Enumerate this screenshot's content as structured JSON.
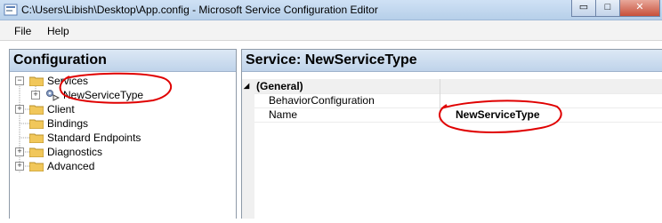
{
  "window": {
    "title": "C:\\Users\\Libish\\Desktop\\App.config - Microsoft Service Configuration Editor",
    "buttons": {
      "minimize": "▭",
      "maximize": "□",
      "close": "✕"
    }
  },
  "menu": {
    "file": "File",
    "help": "Help"
  },
  "left_pane": {
    "header": "Configuration",
    "tree": {
      "services": "Services",
      "service_child": "NewServiceType",
      "client": "Client",
      "bindings": "Bindings",
      "standard_endpoints": "Standard Endpoints",
      "diagnostics": "Diagnostics",
      "advanced": "Advanced"
    },
    "expander_collapsed": "+",
    "expander_expanded": "−"
  },
  "right_pane": {
    "header": "Service: NewServiceType",
    "category": {
      "toggle": "◢",
      "label": "(General)"
    },
    "properties": [
      {
        "name": "BehaviorConfiguration",
        "value": ""
      },
      {
        "name": "Name",
        "value": "NewServiceType"
      }
    ]
  },
  "colors": {
    "annotation": "#e00000",
    "folder": "#f1c75a",
    "header_gradient": "#c8daef"
  }
}
